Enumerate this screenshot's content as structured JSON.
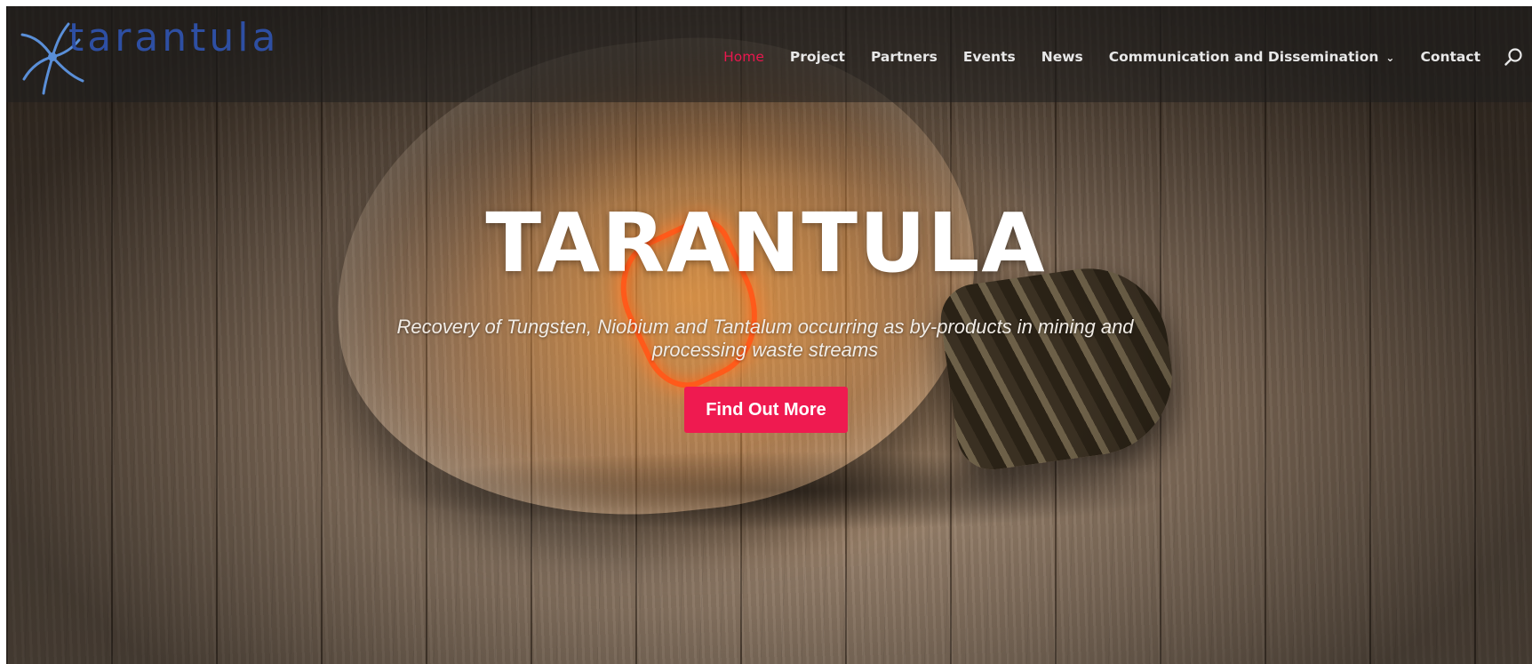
{
  "header": {
    "logo_text": "tarantula"
  },
  "nav": {
    "items": [
      {
        "label": "Home",
        "active": true
      },
      {
        "label": "Project"
      },
      {
        "label": "Partners"
      },
      {
        "label": "Events"
      },
      {
        "label": "News"
      },
      {
        "label": "Communication and Dissemination",
        "has_dropdown": true
      },
      {
        "label": "Contact"
      }
    ],
    "search_icon": "search-icon",
    "dropdown_icon": "chevron-down-icon"
  },
  "hero": {
    "title": "TARANTULA",
    "subtitle": "Recovery of Tungsten, Niobium and Tantalum occurring as by-products in mining and processing waste streams",
    "cta_label": "Find Out More"
  },
  "colors": {
    "accent": "#ef1a50",
    "logo": "#2e4fa3",
    "nav_text": "#e8e8e8"
  }
}
